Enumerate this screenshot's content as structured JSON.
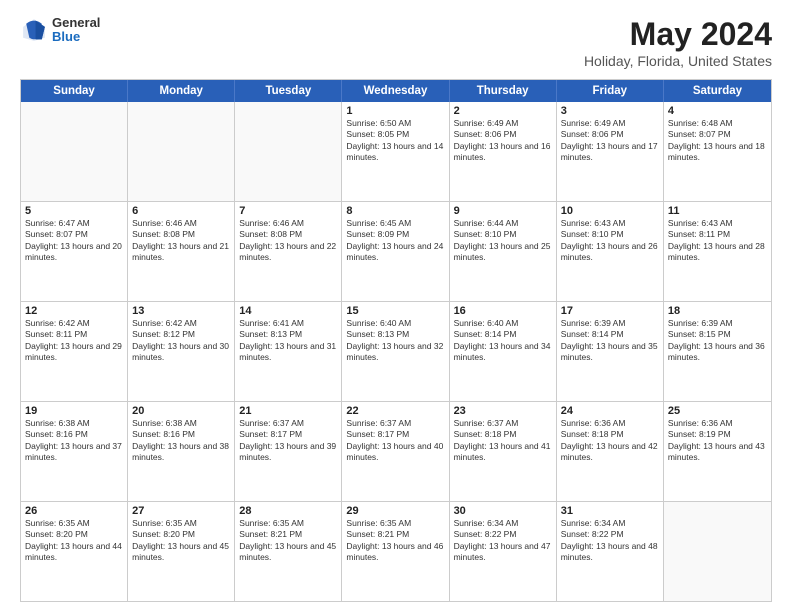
{
  "header": {
    "logo_general": "General",
    "logo_blue": "Blue",
    "title": "May 2024",
    "subtitle": "Holiday, Florida, United States"
  },
  "days_of_week": [
    "Sunday",
    "Monday",
    "Tuesday",
    "Wednesday",
    "Thursday",
    "Friday",
    "Saturday"
  ],
  "weeks": [
    [
      {
        "day": "",
        "info": "",
        "empty": true
      },
      {
        "day": "",
        "info": "",
        "empty": true
      },
      {
        "day": "",
        "info": "",
        "empty": true
      },
      {
        "day": "1",
        "info": "Sunrise: 6:50 AM\nSunset: 8:05 PM\nDaylight: 13 hours and 14 minutes.",
        "empty": false
      },
      {
        "day": "2",
        "info": "Sunrise: 6:49 AM\nSunset: 8:06 PM\nDaylight: 13 hours and 16 minutes.",
        "empty": false
      },
      {
        "day": "3",
        "info": "Sunrise: 6:49 AM\nSunset: 8:06 PM\nDaylight: 13 hours and 17 minutes.",
        "empty": false
      },
      {
        "day": "4",
        "info": "Sunrise: 6:48 AM\nSunset: 8:07 PM\nDaylight: 13 hours and 18 minutes.",
        "empty": false
      }
    ],
    [
      {
        "day": "5",
        "info": "Sunrise: 6:47 AM\nSunset: 8:07 PM\nDaylight: 13 hours and 20 minutes.",
        "empty": false
      },
      {
        "day": "6",
        "info": "Sunrise: 6:46 AM\nSunset: 8:08 PM\nDaylight: 13 hours and 21 minutes.",
        "empty": false
      },
      {
        "day": "7",
        "info": "Sunrise: 6:46 AM\nSunset: 8:08 PM\nDaylight: 13 hours and 22 minutes.",
        "empty": false
      },
      {
        "day": "8",
        "info": "Sunrise: 6:45 AM\nSunset: 8:09 PM\nDaylight: 13 hours and 24 minutes.",
        "empty": false
      },
      {
        "day": "9",
        "info": "Sunrise: 6:44 AM\nSunset: 8:10 PM\nDaylight: 13 hours and 25 minutes.",
        "empty": false
      },
      {
        "day": "10",
        "info": "Sunrise: 6:43 AM\nSunset: 8:10 PM\nDaylight: 13 hours and 26 minutes.",
        "empty": false
      },
      {
        "day": "11",
        "info": "Sunrise: 6:43 AM\nSunset: 8:11 PM\nDaylight: 13 hours and 28 minutes.",
        "empty": false
      }
    ],
    [
      {
        "day": "12",
        "info": "Sunrise: 6:42 AM\nSunset: 8:11 PM\nDaylight: 13 hours and 29 minutes.",
        "empty": false
      },
      {
        "day": "13",
        "info": "Sunrise: 6:42 AM\nSunset: 8:12 PM\nDaylight: 13 hours and 30 minutes.",
        "empty": false
      },
      {
        "day": "14",
        "info": "Sunrise: 6:41 AM\nSunset: 8:13 PM\nDaylight: 13 hours and 31 minutes.",
        "empty": false
      },
      {
        "day": "15",
        "info": "Sunrise: 6:40 AM\nSunset: 8:13 PM\nDaylight: 13 hours and 32 minutes.",
        "empty": false
      },
      {
        "day": "16",
        "info": "Sunrise: 6:40 AM\nSunset: 8:14 PM\nDaylight: 13 hours and 34 minutes.",
        "empty": false
      },
      {
        "day": "17",
        "info": "Sunrise: 6:39 AM\nSunset: 8:14 PM\nDaylight: 13 hours and 35 minutes.",
        "empty": false
      },
      {
        "day": "18",
        "info": "Sunrise: 6:39 AM\nSunset: 8:15 PM\nDaylight: 13 hours and 36 minutes.",
        "empty": false
      }
    ],
    [
      {
        "day": "19",
        "info": "Sunrise: 6:38 AM\nSunset: 8:16 PM\nDaylight: 13 hours and 37 minutes.",
        "empty": false
      },
      {
        "day": "20",
        "info": "Sunrise: 6:38 AM\nSunset: 8:16 PM\nDaylight: 13 hours and 38 minutes.",
        "empty": false
      },
      {
        "day": "21",
        "info": "Sunrise: 6:37 AM\nSunset: 8:17 PM\nDaylight: 13 hours and 39 minutes.",
        "empty": false
      },
      {
        "day": "22",
        "info": "Sunrise: 6:37 AM\nSunset: 8:17 PM\nDaylight: 13 hours and 40 minutes.",
        "empty": false
      },
      {
        "day": "23",
        "info": "Sunrise: 6:37 AM\nSunset: 8:18 PM\nDaylight: 13 hours and 41 minutes.",
        "empty": false
      },
      {
        "day": "24",
        "info": "Sunrise: 6:36 AM\nSunset: 8:18 PM\nDaylight: 13 hours and 42 minutes.",
        "empty": false
      },
      {
        "day": "25",
        "info": "Sunrise: 6:36 AM\nSunset: 8:19 PM\nDaylight: 13 hours and 43 minutes.",
        "empty": false
      }
    ],
    [
      {
        "day": "26",
        "info": "Sunrise: 6:35 AM\nSunset: 8:20 PM\nDaylight: 13 hours and 44 minutes.",
        "empty": false
      },
      {
        "day": "27",
        "info": "Sunrise: 6:35 AM\nSunset: 8:20 PM\nDaylight: 13 hours and 45 minutes.",
        "empty": false
      },
      {
        "day": "28",
        "info": "Sunrise: 6:35 AM\nSunset: 8:21 PM\nDaylight: 13 hours and 45 minutes.",
        "empty": false
      },
      {
        "day": "29",
        "info": "Sunrise: 6:35 AM\nSunset: 8:21 PM\nDaylight: 13 hours and 46 minutes.",
        "empty": false
      },
      {
        "day": "30",
        "info": "Sunrise: 6:34 AM\nSunset: 8:22 PM\nDaylight: 13 hours and 47 minutes.",
        "empty": false
      },
      {
        "day": "31",
        "info": "Sunrise: 6:34 AM\nSunset: 8:22 PM\nDaylight: 13 hours and 48 minutes.",
        "empty": false
      },
      {
        "day": "",
        "info": "",
        "empty": true
      }
    ]
  ]
}
